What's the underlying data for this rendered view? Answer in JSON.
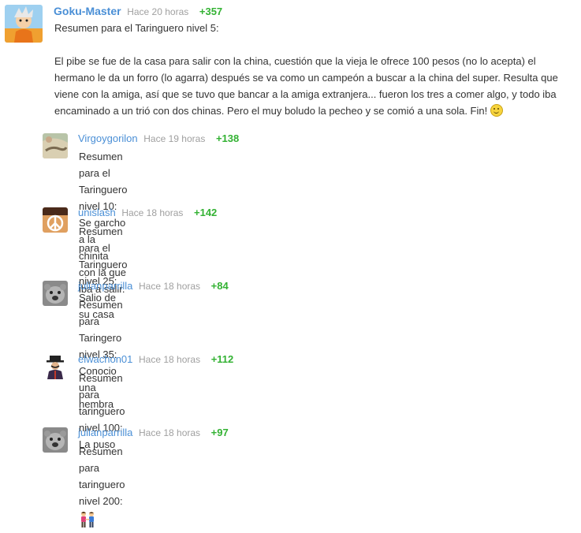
{
  "main_comment": {
    "user": "Goku-Master",
    "time": "Hace 20 horas",
    "score": "+357",
    "line1": "Resumen para el Taringuero nivel 5:",
    "paragraph": "El pibe se fue de la casa para salir con la china, cuestión que la vieja le ofrece 100 pesos (no lo acepta) el hermano le da un forro (lo agarra) después se va como un campeón a buscar a la china del super. Resulta que viene con la amiga, así que se tuvo que bancar a la amiga extranjera... fueron los tres a comer algo, y todo iba encaminado a un trió con dos chinas. Pero el muy boludo la pecheo y se comió a una sola. Fin!",
    "emoji": "smiley-icon"
  },
  "replies": [
    {
      "user": "Virgoygorilon",
      "time": "Hace 19 horas",
      "score": "+138",
      "line1": "Resumen para el Taringuero nivel 10:",
      "line2": "Se garcho a la chinita con la que iba a salir."
    },
    {
      "user": "unislash",
      "time": "Hace 18 horas",
      "score": "+142",
      "line1": "Resumen para el Taringuero nivel 25:",
      "line2": "Salio de su casa"
    },
    {
      "user": "julianparrilla",
      "time": "Hace 18 horas",
      "score": "+84",
      "line1": "Resumen para Taringero nivel 35:",
      "line2": "Conocio una hembra"
    },
    {
      "user": "elwachon01",
      "time": "Hace 18 horas",
      "score": "+112",
      "line1": "Resumen para taringuero nivel 100:",
      "line2": "La puso"
    },
    {
      "user": "julianparrilla",
      "time": "Hace 18 horas",
      "score": "+97",
      "line1": "Resumen para taringuero nivel 200:",
      "line2_icon": "couple-holding-hands-icon"
    }
  ],
  "colors": {
    "username": "#4a8fd6",
    "time": "#a0a0a0",
    "score": "#33b233",
    "text": "#333333"
  }
}
